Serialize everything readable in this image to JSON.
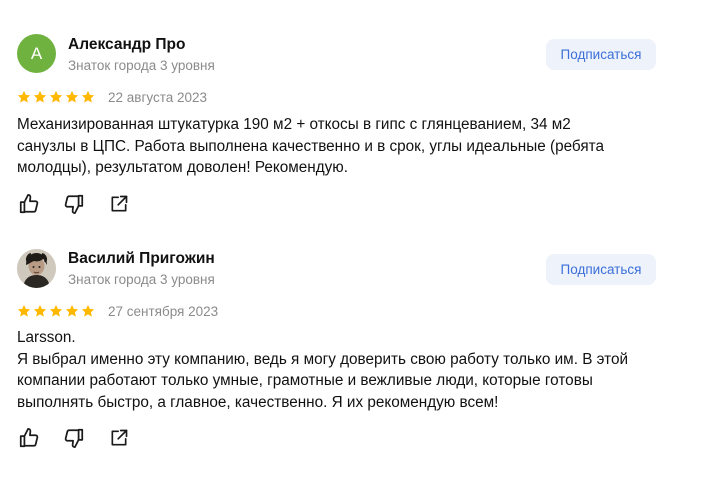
{
  "reviews": [
    {
      "avatar_letter": "А",
      "author": "Александр Про",
      "level": "Знаток города 3 уровня",
      "subscribe_label": "Подписаться",
      "rating": 5,
      "date": "22 августа 2023",
      "text_lines": [
        "Механизированная штукатурка 190 м2 + откосы в гипс с глянцеванием, 34 м2",
        "санузлы в ЦПС. Работа выполнена качественно и в срок, углы идеальные (ребята",
        "молодцы), результатом доволен! Рекомендую."
      ]
    },
    {
      "author": "Василий Пригожин",
      "level": "Знаток города 3 уровня",
      "subscribe_label": "Подписаться",
      "rating": 5,
      "date": "27 сентября 2023",
      "text_lines": [
        "Larsson.",
        "Я выбрал именно эту компанию, ведь я могу доверить свою работу только им. В этой",
        "компании работают только умные, грамотные и вежливые люди, которые готовы",
        "выполнять быстро, а главное, качественно. Я их рекомендую всем!"
      ]
    }
  ],
  "icons": {
    "star": "star-icon",
    "like": "thumbs-up-icon",
    "dislike": "thumbs-down-icon",
    "share": "share-icon"
  },
  "colors": {
    "star": "#ffb800",
    "avatar_green": "#6fb23f",
    "subscribe_bg": "#eef2fa",
    "subscribe_text": "#3b6fd9",
    "muted_text": "#8b8b8b"
  }
}
